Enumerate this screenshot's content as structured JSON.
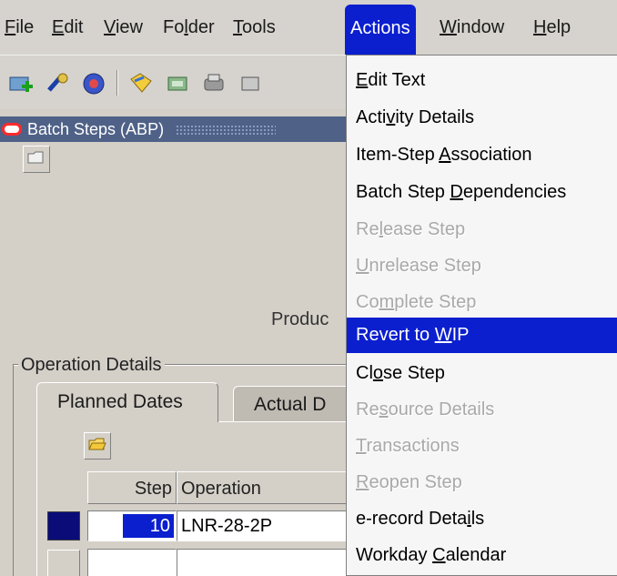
{
  "menubar": {
    "items": [
      {
        "label": "File",
        "u": "F",
        "rest": "ile"
      },
      {
        "label": "Edit",
        "u": "E",
        "rest": "dit"
      },
      {
        "label": "View",
        "u": "V",
        "rest": "iew"
      },
      {
        "label": "Folder",
        "pre": "Fo",
        "u": "l",
        "rest": "der"
      },
      {
        "label": "Tools",
        "u": "T",
        "rest": "ools"
      },
      {
        "label": "Actions"
      },
      {
        "label": "Window",
        "u": "W",
        "rest": "indow"
      },
      {
        "label": "Help",
        "u": "H",
        "rest": "elp"
      }
    ]
  },
  "window": {
    "title": "Batch Steps (ABP)"
  },
  "form": {
    "product_label": "Produc",
    "group_label": "Operation Details",
    "tabs": [
      "Planned Dates",
      "Actual D"
    ],
    "columns": [
      "Step",
      "Operation"
    ],
    "rows": [
      {
        "step": "10",
        "operation": "LNR-28-2P"
      }
    ]
  },
  "actions_menu": {
    "items": [
      {
        "label": "Edit Text",
        "state": "enabled",
        "pre": "",
        "u": "E",
        "rest": "dit Text"
      },
      {
        "label": "Activity Details",
        "state": "enabled",
        "pre": "Acti",
        "u": "v",
        "rest": "ity Details"
      },
      {
        "label": "Item-Step Association",
        "state": "enabled",
        "pre": "Item-Step ",
        "u": "A",
        "rest": "ssociation"
      },
      {
        "label": "Batch Step Dependencies",
        "state": "enabled",
        "pre": "Batch Step ",
        "u": "D",
        "rest": "ependencies"
      },
      {
        "label": "Release Step",
        "state": "disabled",
        "pre": "Re",
        "u": "l",
        "rest": "ease Step"
      },
      {
        "label": "Unrelease Step",
        "state": "disabled",
        "pre": "",
        "u": "U",
        "rest": "nrelease Step"
      },
      {
        "label": "Complete Step",
        "state": "disabled",
        "pre": "Co",
        "u": "m",
        "rest": "plete Step"
      },
      {
        "label": "Revert to WIP",
        "state": "selected",
        "pre": "Revert to ",
        "u": "W",
        "rest": "IP"
      },
      {
        "label": "Close Step",
        "state": "enabled",
        "pre": "Cl",
        "u": "o",
        "rest": "se Step"
      },
      {
        "label": "Resource Details",
        "state": "disabled",
        "pre": "Re",
        "u": "s",
        "rest": "ource Details"
      },
      {
        "label": "Transactions",
        "state": "disabled",
        "pre": "",
        "u": "T",
        "rest": "ransactions"
      },
      {
        "label": "Reopen Step",
        "state": "disabled",
        "pre": "",
        "u": "R",
        "rest": "eopen Step"
      },
      {
        "label": "e-record Details",
        "state": "enabled",
        "pre": "e-record Deta",
        "u": "i",
        "rest": "ls"
      },
      {
        "label": "Workday Calendar",
        "state": "enabled",
        "pre": "Workday ",
        "u": "C",
        "rest": "alendar"
      }
    ]
  },
  "colors": {
    "selection": "#0b1fcf",
    "window_title_bar": "#4f6187",
    "disabled_text": "#a9a9a9"
  }
}
